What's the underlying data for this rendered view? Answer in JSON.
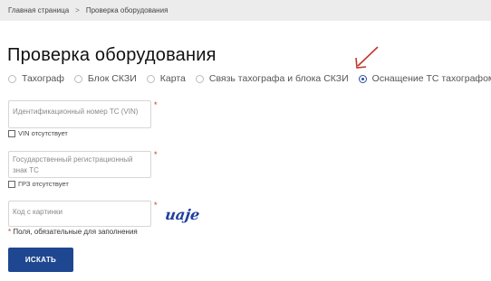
{
  "breadcrumb": {
    "home": "Главная страница",
    "separator": ">",
    "current": "Проверка оборудования"
  },
  "page": {
    "title": "Проверка оборудования"
  },
  "radio_options": [
    {
      "label": "Тахограф",
      "selected": false
    },
    {
      "label": "Блок СКЗИ",
      "selected": false
    },
    {
      "label": "Карта",
      "selected": false
    },
    {
      "label": "Связь тахографа и блока СКЗИ",
      "selected": false
    },
    {
      "label": "Оснащение ТС тахографом",
      "selected": true
    }
  ],
  "form": {
    "vin_placeholder": "Идентификационный номер ТС (VIN)",
    "vin_missing_label": "VIN отсутствует",
    "grz_placeholder": "Государственный регистрационный знак ТС",
    "grz_missing_label": "ГРЗ отсутствует",
    "captcha_placeholder": "Код с картинки",
    "captcha_text": "uaje",
    "required_mark": "*",
    "required_note": "Поля, обязательные для заполнения",
    "submit_label": "ИСКАТЬ"
  },
  "colors": {
    "accent": "#1f4791",
    "required": "#c0392b",
    "annotation_arrow": "#c0392b"
  }
}
